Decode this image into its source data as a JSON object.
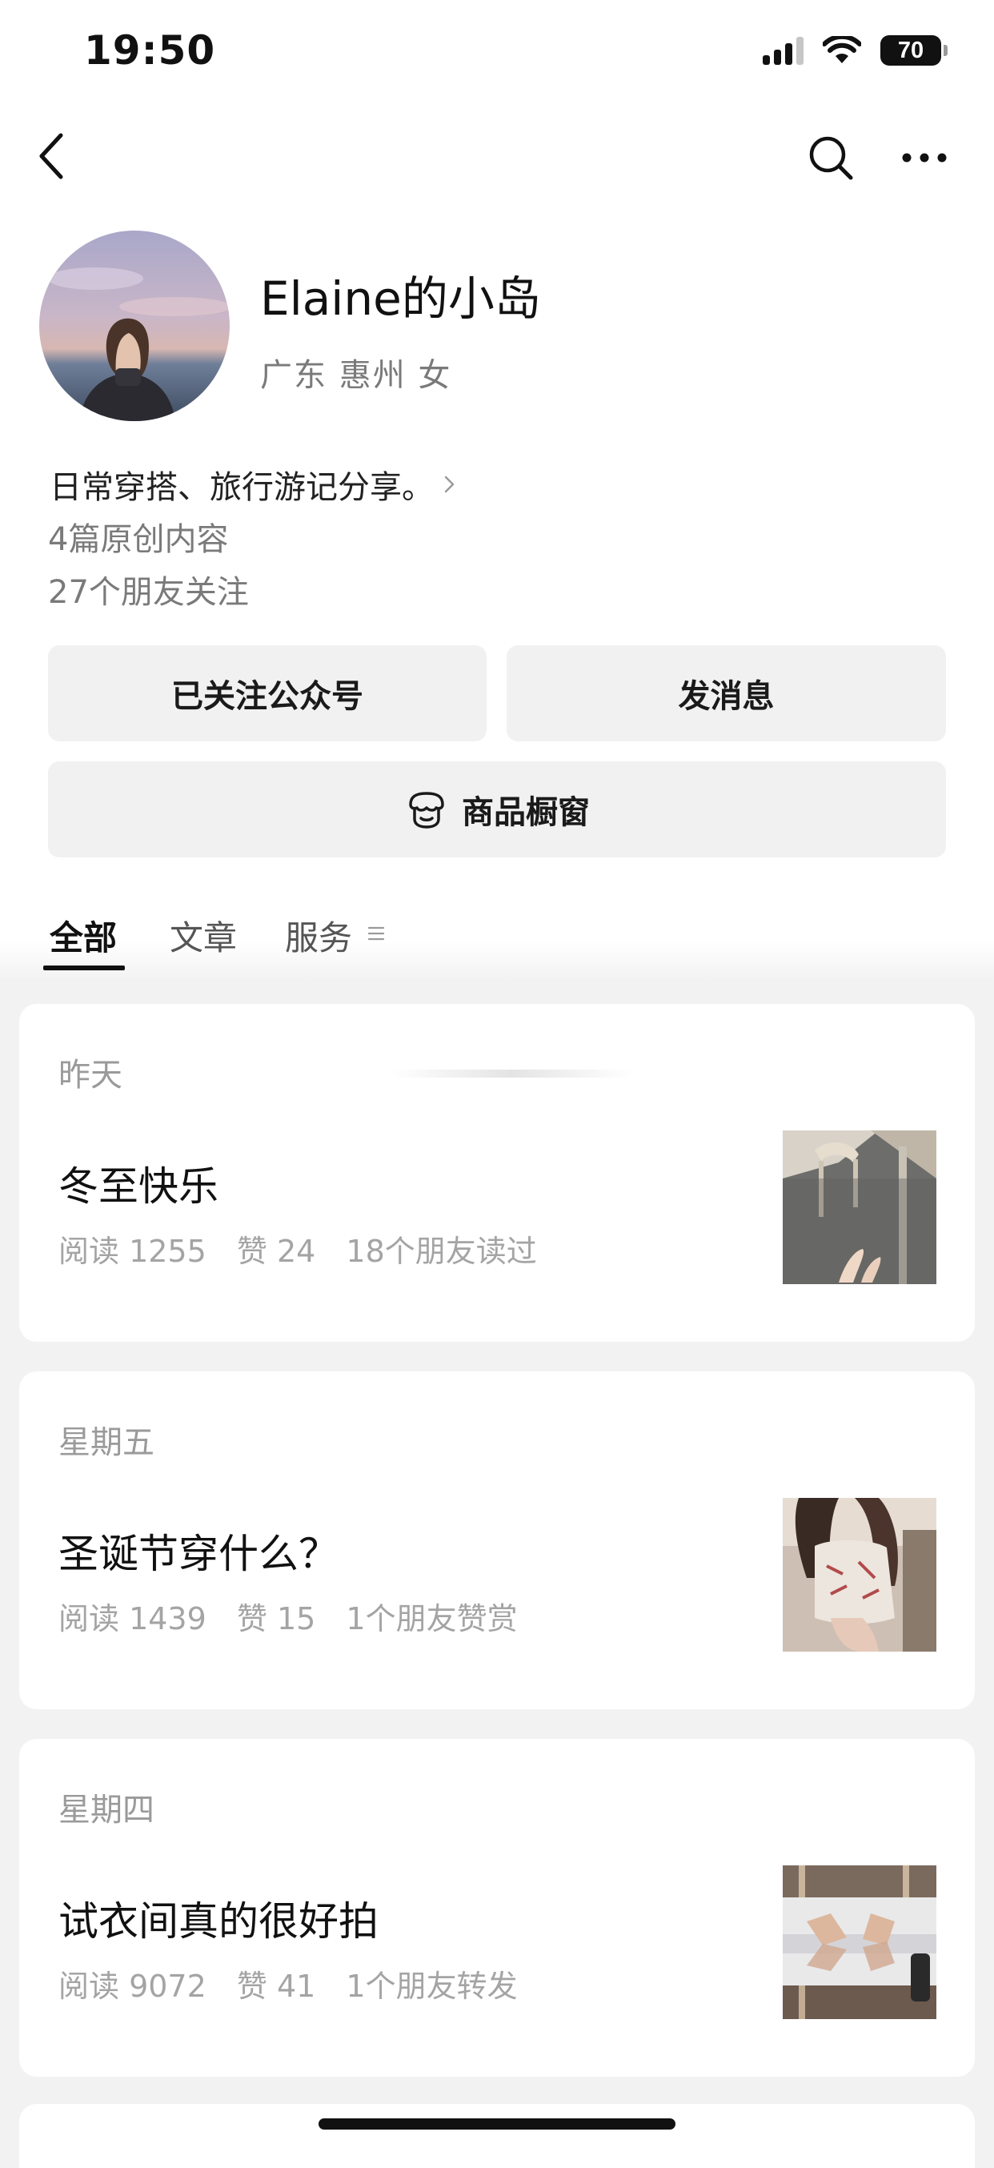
{
  "status_bar": {
    "time": "19:50",
    "battery": "70"
  },
  "nav": {
    "back_icon": "chevron-left-icon",
    "search_icon": "search-icon",
    "more_icon": "more-horizontal-icon"
  },
  "profile": {
    "name": "Elaine的小岛",
    "location": "广东 惠州 女",
    "bio": "日常穿搭、旅行游记分享。",
    "original_count": "4篇原创内容",
    "friends_following": "27个朋友关注"
  },
  "actions": {
    "follow_label": "已关注公众号",
    "message_label": "发消息",
    "shop_label": "商品橱窗"
  },
  "tabs": [
    {
      "label": "全部",
      "active": true
    },
    {
      "label": "文章",
      "active": false
    },
    {
      "label": "服务",
      "active": false
    }
  ],
  "articles": [
    {
      "date": "昨天",
      "title": "冬至快乐",
      "reads": "阅读 1255",
      "likes": "赞 24",
      "social": "18个朋友读过"
    },
    {
      "date": "星期五",
      "title": "圣诞节穿什么？",
      "reads": "阅读 1439",
      "likes": "赞 15",
      "social": "1个朋友赞赏"
    },
    {
      "date": "星期四",
      "title": "试衣间真的很好拍",
      "reads": "阅读 9072",
      "likes": "赞 41",
      "social": "1个朋友转发"
    }
  ]
}
